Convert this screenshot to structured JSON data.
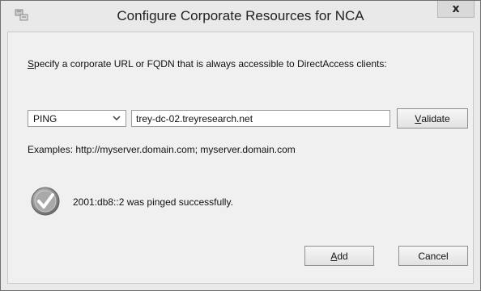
{
  "window": {
    "title": "Configure Corporate Resources for NCA",
    "close_symbol": "x",
    "icon": "network-settings-icon"
  },
  "form": {
    "instruction_mnemonic": "S",
    "instruction_rest": "pecify a corporate URL or FQDN that is always accessible to DirectAccess clients:",
    "protocol_selected": "PING",
    "url_value": "trey-dc-02.treyresearch.net",
    "examples": "Examples: http://myserver.domain.com; myserver.domain.com"
  },
  "buttons": {
    "validate_mnemonic": "V",
    "validate_rest": "alidate",
    "add_mnemonic": "A",
    "add_rest": "dd",
    "cancel": "Cancel"
  },
  "status": {
    "icon": "checkmark-success-icon",
    "message": "2001:db8::2 was pinged successfully."
  }
}
